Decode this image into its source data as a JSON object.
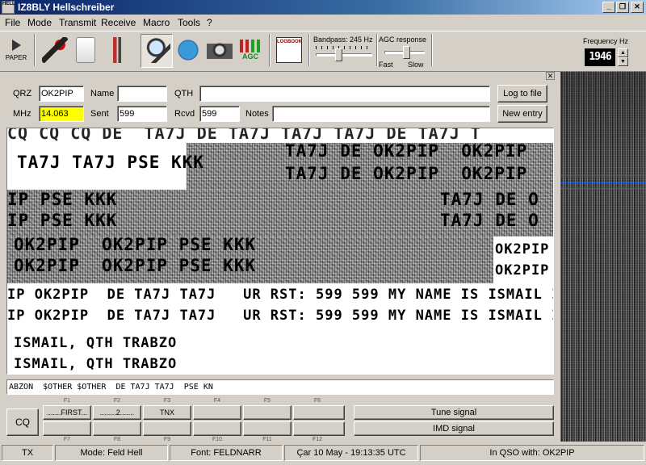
{
  "window": {
    "title": "IZ8BLY Hellschreiber",
    "app_icon_text": "HELL"
  },
  "menu": [
    "File",
    "Mode",
    "Transmit",
    "Receive",
    "Macro",
    "Tools",
    "?"
  ],
  "toolbar": {
    "paper_label": "PAPER",
    "agc_label": "AGC",
    "logbook_label": "LOGBOOK",
    "bandpass_label": "Bandpass: 245 Hz",
    "agc_response_label": "AGC response",
    "fast_label": "Fast",
    "slow_label": "Slow",
    "frequency_label": "Frequency Hz",
    "frequency_value": "1946",
    "bandpass_level": 0.4,
    "agc_response_level": 0.55
  },
  "log": {
    "qrz_label": "QRZ",
    "qrz_value": "OK2PIP",
    "name_label": "Name",
    "name_value": "",
    "qth_label": "QTH",
    "qth_value": "",
    "mhz_label": "MHz",
    "mhz_value": "14.063",
    "sent_label": "Sent",
    "sent_value": "599",
    "rcvd_label": "Rcvd",
    "rcvd_value": "599",
    "notes_label": "Notes",
    "notes_value": "",
    "log_to_file": "Log to file",
    "new_entry": "New entry"
  },
  "receive": {
    "line1_top": "CQ CQ CQ DE  TA7J DE TA7J TA7J TA7J DE TA7J T",
    "line1_a": "TA7J TA7J PSE KKK",
    "line1_b": "TA7J DE OK2PIP  OK2PIP",
    "line2_a": "IP PSE KKK",
    "line2_b": "TA7J DE OK2PIP  OK2PIP",
    "line2_c": "TA7J DE O",
    "line2_d": "TA7J DE O",
    "line3_a": "OK2PIP  OK2PIP PSE KKK",
    "line3_b": "OK2PIP",
    "line4": "IP OK2PIP  DE TA7J TA7J   UR RST: 599 599 MY NAME IS ISMAIL IS",
    "line5": "ISMAIL, QTH TRABZO"
  },
  "transmit": {
    "text": "ABZON  $OTHER $OTHER  DE TA7J TA7J  PSE KN"
  },
  "macros": {
    "cq": "CQ",
    "f_top": [
      "F1",
      "F2",
      "F3",
      "F4",
      "F5",
      "F6"
    ],
    "f_bottom": [
      "F7",
      "F8",
      "F9",
      "F10",
      "F11",
      "F12"
    ],
    "row1": [
      ".......FIRST...",
      "........2.......",
      "TNX",
      "",
      "",
      ""
    ],
    "row2": [
      "",
      "",
      "",
      "",
      "",
      ""
    ],
    "tune_signal": "Tune signal",
    "imd_signal": "IMD signal"
  },
  "status": {
    "tx": "TX",
    "mode": "Mode: Feld Hell",
    "font": "Font: FELDNARR",
    "datetime": "Çar 10 May - 19:13:35 UTC",
    "qso": "In QSO with: OK2PIP"
  },
  "colors": {
    "title_bar": "#0a246a",
    "mhz_highlight": "#ffff00",
    "marker_red": "#e02020",
    "marker_blue": "#2060e0"
  }
}
